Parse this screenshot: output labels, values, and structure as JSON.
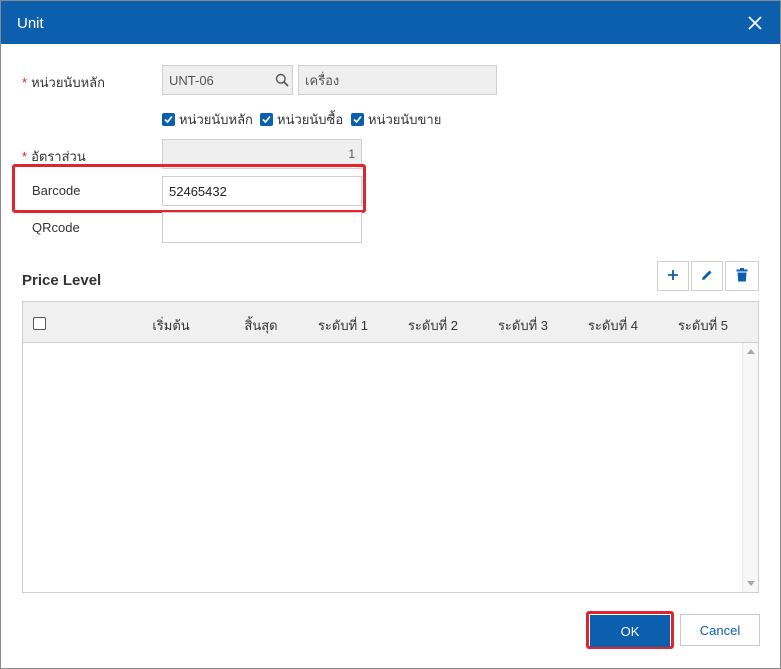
{
  "dialog": {
    "title": "Unit",
    "close_icon": "close-icon"
  },
  "form": {
    "main_unit_label": "หน่วยนับหลัก",
    "unit_code": "UNT-06",
    "unit_name": "เครื่อง",
    "checkboxes": [
      {
        "label": "หน่วยนับหลัก",
        "checked": true
      },
      {
        "label": "หน่วยนับซื้อ",
        "checked": true
      },
      {
        "label": "หน่วยนับขาย",
        "checked": true
      }
    ],
    "ratio_label": "อัตราส่วน",
    "ratio_value": "1",
    "barcode_label": "Barcode",
    "barcode_value": "52465432",
    "qrcode_label": "QRcode",
    "qrcode_value": ""
  },
  "price_level": {
    "title": "Price Level",
    "columns": [
      "เริ่มต้น",
      "สิ้นสุด",
      "ระดับที่ 1",
      "ระดับที่ 2",
      "ระดับที่ 3",
      "ระดับที่ 4",
      "ระดับที่ 5"
    ],
    "rows": []
  },
  "buttons": {
    "ok": "OK",
    "cancel": "Cancel"
  },
  "colors": {
    "header_blue": "#0b5fad",
    "highlight_red": "#e0252e",
    "required_red": "#d9261c"
  }
}
